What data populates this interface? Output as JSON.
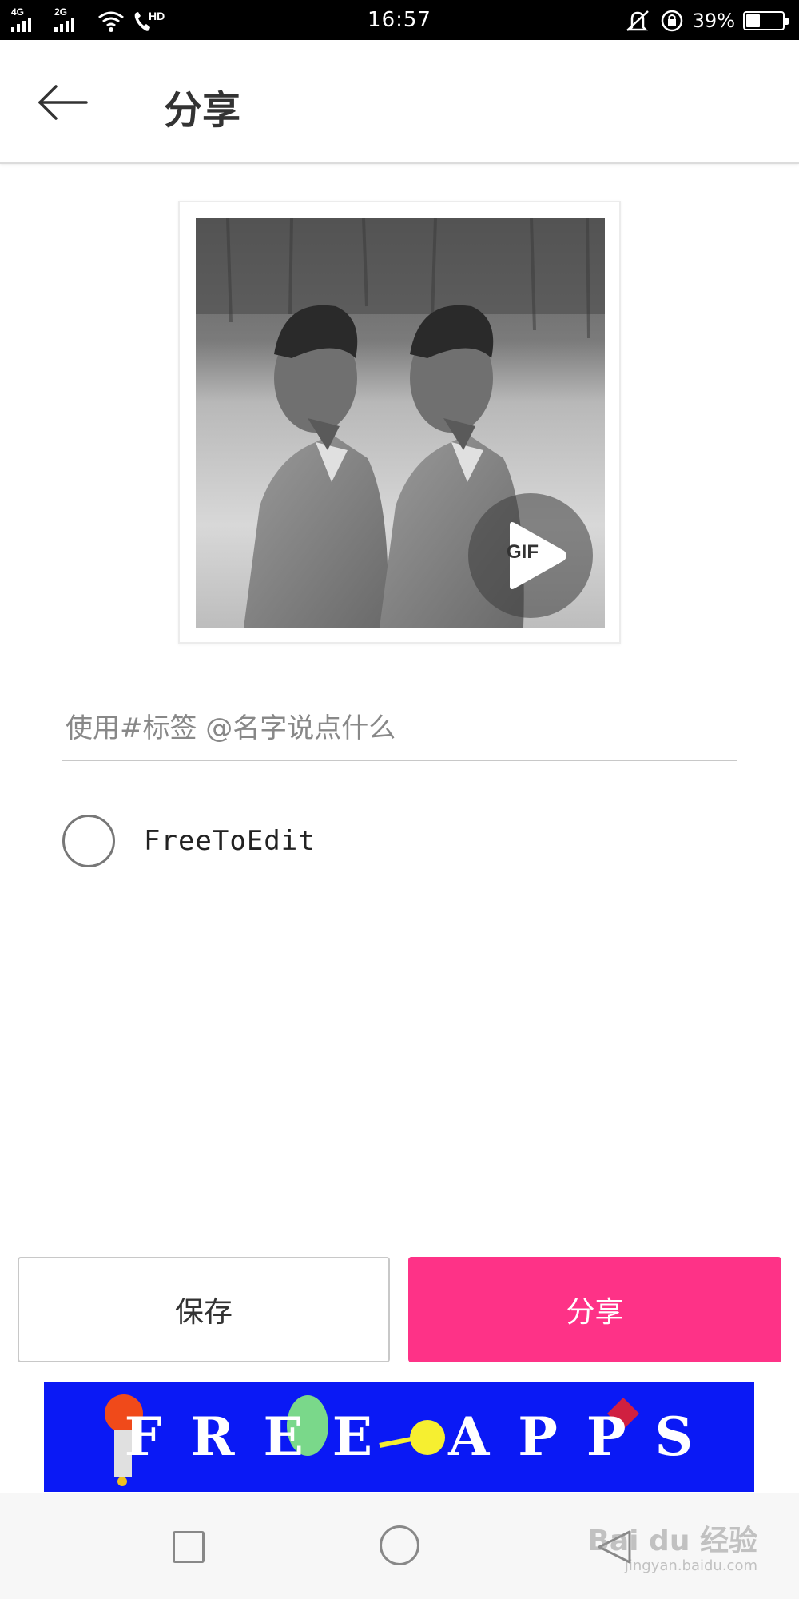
{
  "status_bar": {
    "sim1_network": "4G",
    "sim2_network": "2G",
    "call_badge": "HD",
    "time": "16:57",
    "battery_percent": "39%",
    "battery_level": 0.39
  },
  "header": {
    "title": "分享",
    "back_icon": "arrow-left-icon"
  },
  "preview": {
    "badge_label": "GIF",
    "badge_icon": "play-icon"
  },
  "caption": {
    "placeholder": "使用#标签 @名字说点什么",
    "value": ""
  },
  "free_to_edit": {
    "label": "FreeToEdit",
    "checked": false
  },
  "buttons": {
    "save_label": "保存",
    "share_label": "分享"
  },
  "ad": {
    "text": "FREE APPS"
  },
  "nav": {
    "recents_icon": "square-icon",
    "home_icon": "circle-icon",
    "back_icon": "triangle-back-icon"
  },
  "watermark": {
    "text": "Bai du 经验",
    "sub": "jingyan.baidu.com"
  },
  "colors": {
    "accent": "#fe3287",
    "ad_background": "#0a19f5"
  }
}
